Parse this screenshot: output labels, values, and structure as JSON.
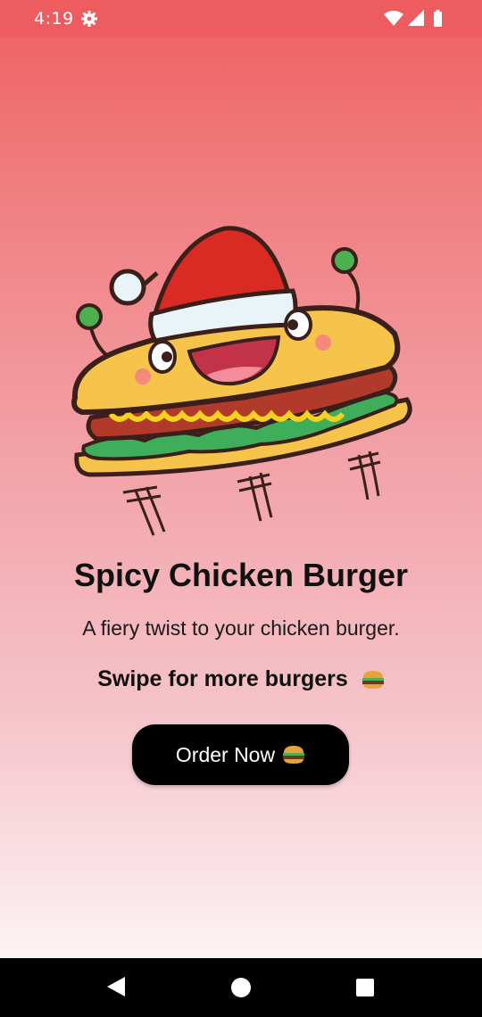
{
  "status_bar": {
    "time": "4:19",
    "icons": [
      "settings-gear-icon",
      "wifi-icon",
      "cellular-signal-icon",
      "battery-icon"
    ]
  },
  "hero": {
    "icon": "cartoon-burger-mascot-with-santa-hat"
  },
  "product": {
    "title": "Spicy Chicken Burger",
    "description": "A fiery twist to your chicken burger.",
    "swipe_hint": "Swipe for more burgers"
  },
  "order_button": {
    "label": "Order Now"
  },
  "nav_bar": {
    "icons": [
      "back-icon",
      "home-icon",
      "recents-icon"
    ]
  },
  "colors": {
    "status_bar": "#ed5c5e",
    "gradient_top": "#ee5f60",
    "gradient_bottom": "#fdf3f5",
    "button": "#000000",
    "text": "#111111"
  }
}
